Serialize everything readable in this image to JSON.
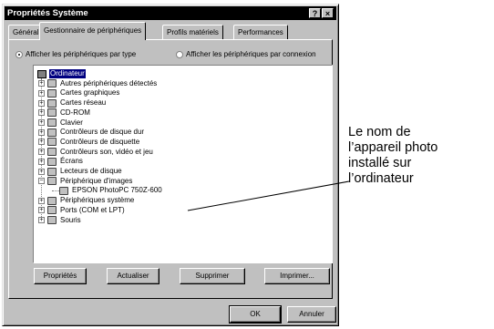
{
  "window": {
    "title": "Propriétés Système",
    "help_glyph": "?",
    "close_glyph": "×"
  },
  "tabs": [
    "Général",
    "Gestionnaire de périphériques",
    "Profils matériels",
    "Performances"
  ],
  "view_options": {
    "by_type": "Afficher les périphériques par type",
    "by_connection": "Afficher les périphériques par connexion",
    "selected": "by_type"
  },
  "tree": {
    "root": "Ordinateur",
    "items": [
      {
        "label": "Autres périphériques détectés",
        "toggle": "+",
        "icon": "unknown-device-icon"
      },
      {
        "label": "Cartes graphiques",
        "toggle": "+",
        "icon": "display-adapter-icon"
      },
      {
        "label": "Cartes réseau",
        "toggle": "+",
        "icon": "network-adapter-icon"
      },
      {
        "label": "CD-ROM",
        "toggle": "+",
        "icon": "cdrom-icon"
      },
      {
        "label": "Clavier",
        "toggle": "+",
        "icon": "keyboard-icon"
      },
      {
        "label": "Contrôleurs de disque dur",
        "toggle": "+",
        "icon": "hard-disk-controller-icon"
      },
      {
        "label": "Contrôleurs de disquette",
        "toggle": "+",
        "icon": "floppy-controller-icon"
      },
      {
        "label": "Contrôleurs son, vidéo et jeu",
        "toggle": "+",
        "icon": "sound-controller-icon"
      },
      {
        "label": "Écrans",
        "toggle": "+",
        "icon": "monitor-icon"
      },
      {
        "label": "Lecteurs de disque",
        "toggle": "+",
        "icon": "disk-drive-icon"
      },
      {
        "label": "Périphérique d'images",
        "toggle": "−",
        "icon": "imaging-device-icon"
      },
      {
        "label": "EPSON PhotoPC 750Z-600",
        "toggle": "",
        "icon": "camera-icon",
        "child": true
      },
      {
        "label": "Périphériques système",
        "toggle": "+",
        "icon": "system-device-icon"
      },
      {
        "label": "Ports (COM et LPT)",
        "toggle": "+",
        "icon": "port-icon"
      },
      {
        "label": "Souris",
        "toggle": "+",
        "icon": "mouse-icon"
      }
    ]
  },
  "buttons": {
    "properties": "Propriétés",
    "refresh": "Actualiser",
    "remove": "Supprimer",
    "print": "Imprimer...",
    "ok": "OK",
    "cancel": "Annuler"
  },
  "callout": {
    "lines": [
      "Le nom de",
      "l’appareil photo",
      "installé sur",
      "l’ordinateur"
    ]
  }
}
